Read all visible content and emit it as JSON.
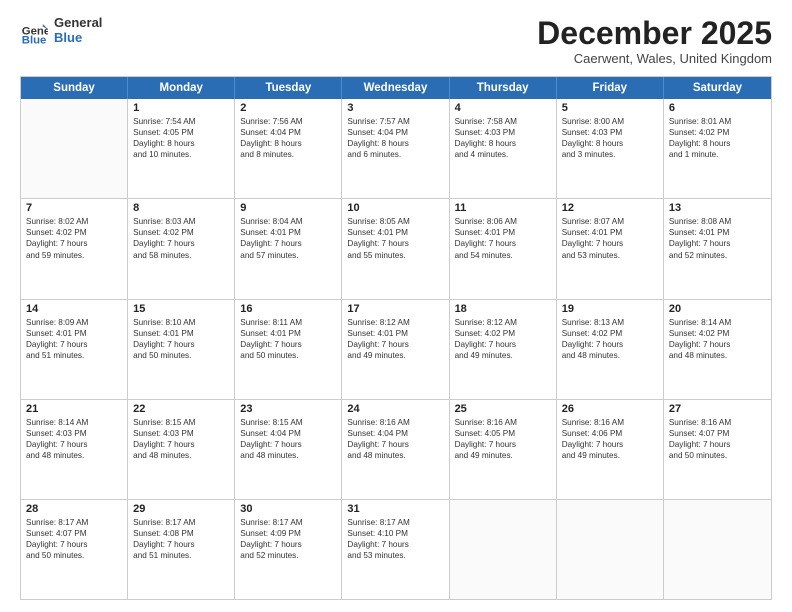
{
  "logo": {
    "line1": "General",
    "line2": "Blue"
  },
  "title": "December 2025",
  "subtitle": "Caerwent, Wales, United Kingdom",
  "header_days": [
    "Sunday",
    "Monday",
    "Tuesday",
    "Wednesday",
    "Thursday",
    "Friday",
    "Saturday"
  ],
  "rows": [
    [
      {
        "day": "",
        "lines": []
      },
      {
        "day": "1",
        "lines": [
          "Sunrise: 7:54 AM",
          "Sunset: 4:05 PM",
          "Daylight: 8 hours",
          "and 10 minutes."
        ]
      },
      {
        "day": "2",
        "lines": [
          "Sunrise: 7:56 AM",
          "Sunset: 4:04 PM",
          "Daylight: 8 hours",
          "and 8 minutes."
        ]
      },
      {
        "day": "3",
        "lines": [
          "Sunrise: 7:57 AM",
          "Sunset: 4:04 PM",
          "Daylight: 8 hours",
          "and 6 minutes."
        ]
      },
      {
        "day": "4",
        "lines": [
          "Sunrise: 7:58 AM",
          "Sunset: 4:03 PM",
          "Daylight: 8 hours",
          "and 4 minutes."
        ]
      },
      {
        "day": "5",
        "lines": [
          "Sunrise: 8:00 AM",
          "Sunset: 4:03 PM",
          "Daylight: 8 hours",
          "and 3 minutes."
        ]
      },
      {
        "day": "6",
        "lines": [
          "Sunrise: 8:01 AM",
          "Sunset: 4:02 PM",
          "Daylight: 8 hours",
          "and 1 minute."
        ]
      }
    ],
    [
      {
        "day": "7",
        "lines": [
          "Sunrise: 8:02 AM",
          "Sunset: 4:02 PM",
          "Daylight: 7 hours",
          "and 59 minutes."
        ]
      },
      {
        "day": "8",
        "lines": [
          "Sunrise: 8:03 AM",
          "Sunset: 4:02 PM",
          "Daylight: 7 hours",
          "and 58 minutes."
        ]
      },
      {
        "day": "9",
        "lines": [
          "Sunrise: 8:04 AM",
          "Sunset: 4:01 PM",
          "Daylight: 7 hours",
          "and 57 minutes."
        ]
      },
      {
        "day": "10",
        "lines": [
          "Sunrise: 8:05 AM",
          "Sunset: 4:01 PM",
          "Daylight: 7 hours",
          "and 55 minutes."
        ]
      },
      {
        "day": "11",
        "lines": [
          "Sunrise: 8:06 AM",
          "Sunset: 4:01 PM",
          "Daylight: 7 hours",
          "and 54 minutes."
        ]
      },
      {
        "day": "12",
        "lines": [
          "Sunrise: 8:07 AM",
          "Sunset: 4:01 PM",
          "Daylight: 7 hours",
          "and 53 minutes."
        ]
      },
      {
        "day": "13",
        "lines": [
          "Sunrise: 8:08 AM",
          "Sunset: 4:01 PM",
          "Daylight: 7 hours",
          "and 52 minutes."
        ]
      }
    ],
    [
      {
        "day": "14",
        "lines": [
          "Sunrise: 8:09 AM",
          "Sunset: 4:01 PM",
          "Daylight: 7 hours",
          "and 51 minutes."
        ]
      },
      {
        "day": "15",
        "lines": [
          "Sunrise: 8:10 AM",
          "Sunset: 4:01 PM",
          "Daylight: 7 hours",
          "and 50 minutes."
        ]
      },
      {
        "day": "16",
        "lines": [
          "Sunrise: 8:11 AM",
          "Sunset: 4:01 PM",
          "Daylight: 7 hours",
          "and 50 minutes."
        ]
      },
      {
        "day": "17",
        "lines": [
          "Sunrise: 8:12 AM",
          "Sunset: 4:01 PM",
          "Daylight: 7 hours",
          "and 49 minutes."
        ]
      },
      {
        "day": "18",
        "lines": [
          "Sunrise: 8:12 AM",
          "Sunset: 4:02 PM",
          "Daylight: 7 hours",
          "and 49 minutes."
        ]
      },
      {
        "day": "19",
        "lines": [
          "Sunrise: 8:13 AM",
          "Sunset: 4:02 PM",
          "Daylight: 7 hours",
          "and 48 minutes."
        ]
      },
      {
        "day": "20",
        "lines": [
          "Sunrise: 8:14 AM",
          "Sunset: 4:02 PM",
          "Daylight: 7 hours",
          "and 48 minutes."
        ]
      }
    ],
    [
      {
        "day": "21",
        "lines": [
          "Sunrise: 8:14 AM",
          "Sunset: 4:03 PM",
          "Daylight: 7 hours",
          "and 48 minutes."
        ]
      },
      {
        "day": "22",
        "lines": [
          "Sunrise: 8:15 AM",
          "Sunset: 4:03 PM",
          "Daylight: 7 hours",
          "and 48 minutes."
        ]
      },
      {
        "day": "23",
        "lines": [
          "Sunrise: 8:15 AM",
          "Sunset: 4:04 PM",
          "Daylight: 7 hours",
          "and 48 minutes."
        ]
      },
      {
        "day": "24",
        "lines": [
          "Sunrise: 8:16 AM",
          "Sunset: 4:04 PM",
          "Daylight: 7 hours",
          "and 48 minutes."
        ]
      },
      {
        "day": "25",
        "lines": [
          "Sunrise: 8:16 AM",
          "Sunset: 4:05 PM",
          "Daylight: 7 hours",
          "and 49 minutes."
        ]
      },
      {
        "day": "26",
        "lines": [
          "Sunrise: 8:16 AM",
          "Sunset: 4:06 PM",
          "Daylight: 7 hours",
          "and 49 minutes."
        ]
      },
      {
        "day": "27",
        "lines": [
          "Sunrise: 8:16 AM",
          "Sunset: 4:07 PM",
          "Daylight: 7 hours",
          "and 50 minutes."
        ]
      }
    ],
    [
      {
        "day": "28",
        "lines": [
          "Sunrise: 8:17 AM",
          "Sunset: 4:07 PM",
          "Daylight: 7 hours",
          "and 50 minutes."
        ]
      },
      {
        "day": "29",
        "lines": [
          "Sunrise: 8:17 AM",
          "Sunset: 4:08 PM",
          "Daylight: 7 hours",
          "and 51 minutes."
        ]
      },
      {
        "day": "30",
        "lines": [
          "Sunrise: 8:17 AM",
          "Sunset: 4:09 PM",
          "Daylight: 7 hours",
          "and 52 minutes."
        ]
      },
      {
        "day": "31",
        "lines": [
          "Sunrise: 8:17 AM",
          "Sunset: 4:10 PM",
          "Daylight: 7 hours",
          "and 53 minutes."
        ]
      },
      {
        "day": "",
        "lines": []
      },
      {
        "day": "",
        "lines": []
      },
      {
        "day": "",
        "lines": []
      }
    ]
  ]
}
